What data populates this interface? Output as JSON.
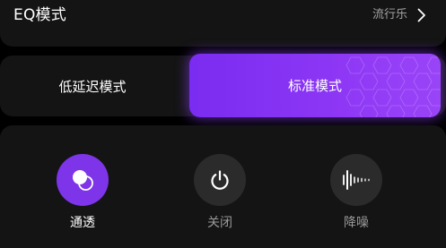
{
  "eq": {
    "title": "EQ模式",
    "value": "流行乐"
  },
  "modes": {
    "low_latency": "低延迟模式",
    "standard": "标准模式",
    "selected": "standard"
  },
  "controls": {
    "transparent": "通透",
    "off": "关闭",
    "noise_cancel": "降噪",
    "selected": "transparent"
  },
  "icons": {
    "eq_chevron": "chevron-right-icon",
    "transparent": "overlapping-circles-icon",
    "off": "power-icon",
    "noise_cancel": "soundwave-icon"
  },
  "colors": {
    "accent": "#8c36f5",
    "panel": "#141414",
    "inactive_button": "#2b2b2b",
    "muted_text": "#9a9a9a"
  }
}
